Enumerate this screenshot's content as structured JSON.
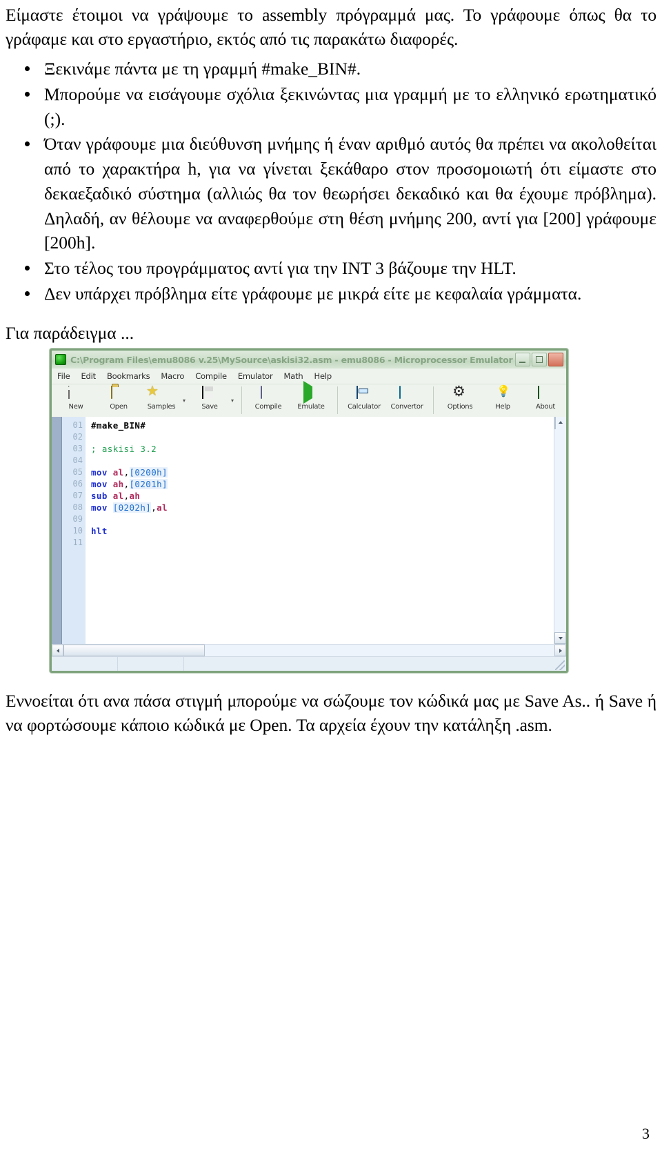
{
  "document": {
    "intro": "Είμαστε έτοιμοι να γράψουμε το assembly πρόγραμμά μας. Το γράφουμε όπως θα το γράφαμε και στο εργαστήριο, εκτός από τις παρακάτω διαφορές.",
    "bullets": [
      "Ξεκινάμε πάντα με τη γραμμή #make_BIN#.",
      "Μπορούμε να εισάγουμε σχόλια ξεκινώντας μια γραμμή με το ελληνικό ερωτηματικό (;).",
      "Όταν γράφουμε μια διεύθυνση μνήμης ή έναν αριθμό αυτός θα πρέπει να ακολοθείται από το χαρακτήρα h, για να γίνεται ξεκάθαρο στον προσομοιωτή ότι είμαστε στο δεκαεξαδικό σύστημα (αλλιώς θα τον θεωρήσει δεκαδικό και θα έχουμε πρόβλημα). Δηλαδή, αν θέλουμε να αναφερθούμε στη θέση μνήμης 200, αντί για [200] γράφουμε [200h].",
      "Στο τέλος του προγράμματος αντί για την INT 3 βάζουμε την HLT.",
      "Δεν υπάρχει πρόβλημα είτε γράφουμε με μικρά είτε με κεφαλαία γράμματα."
    ],
    "example_lead": "Για παράδειγμα ...",
    "footer": "Εννοείται ότι ανα πάσα στιγμή μπορούμε να σώζουμε τον κώδικά μας με Save As.. ή Save ή να φορτώσουμε κάποιο κώδικά με Open. Τα αρχεία έχουν την κατάληξη .asm.",
    "page_number": "3"
  },
  "screenshot": {
    "window": {
      "title": "C:\\Program Files\\emu8086 v.25\\MySource\\askisi32.asm - emu8086 - Microprocessor Emulator a...",
      "app_icon": "emu8086-icon",
      "buttons": [
        {
          "name": "minimize",
          "glyph": "_"
        },
        {
          "name": "maximize",
          "glyph": "□"
        },
        {
          "name": "close",
          "glyph": "✕"
        }
      ]
    },
    "menubar": [
      "File",
      "Edit",
      "Bookmarks",
      "Macro",
      "Compile",
      "Emulator",
      "Math",
      "Help"
    ],
    "toolbar": [
      {
        "label": "New",
        "icon": "new-file-icon",
        "dropdown": false
      },
      {
        "label": "Open",
        "icon": "open-folder-icon",
        "dropdown": false
      },
      {
        "label": "Samples",
        "icon": "star-icon",
        "dropdown": true
      },
      {
        "label": "Save",
        "icon": "floppy-disk-icon",
        "dropdown": true
      },
      {
        "label": "Compile",
        "icon": "compile-icon",
        "dropdown": false
      },
      {
        "label": "Emulate",
        "icon": "play-icon",
        "dropdown": false
      },
      {
        "label": "Calculator",
        "icon": "calculator-icon",
        "dropdown": false
      },
      {
        "label": "Convertor",
        "icon": "convertor-icon",
        "dropdown": false
      },
      {
        "label": "Options",
        "icon": "gear-icon",
        "dropdown": false
      },
      {
        "label": "Help",
        "icon": "lightbulb-icon",
        "dropdown": false
      },
      {
        "label": "About",
        "icon": "about-icon",
        "dropdown": false
      }
    ],
    "editor": {
      "line_numbers": [
        "01",
        "02",
        "03",
        "04",
        "05",
        "06",
        "07",
        "08",
        "09",
        "10",
        "11"
      ],
      "lines": [
        {
          "n": "01",
          "tokens": [
            {
              "t": "#make_BIN#",
              "c": "dir"
            }
          ]
        },
        {
          "n": "02",
          "tokens": []
        },
        {
          "n": "03",
          "tokens": [
            {
              "t": "; askisi 3.2",
              "c": "com"
            }
          ]
        },
        {
          "n": "04",
          "tokens": []
        },
        {
          "n": "05",
          "tokens": [
            {
              "t": "mov ",
              "c": "op"
            },
            {
              "t": "al",
              "c": "reg"
            },
            {
              "t": ",",
              "c": "plain"
            },
            {
              "t": "[0200h]",
              "c": "mem"
            }
          ]
        },
        {
          "n": "06",
          "tokens": [
            {
              "t": "mov ",
              "c": "op"
            },
            {
              "t": "ah",
              "c": "reg"
            },
            {
              "t": ",",
              "c": "plain"
            },
            {
              "t": "[0201h]",
              "c": "mem"
            }
          ]
        },
        {
          "n": "07",
          "tokens": [
            {
              "t": "sub ",
              "c": "op"
            },
            {
              "t": "al",
              "c": "reg"
            },
            {
              "t": ",",
              "c": "plain"
            },
            {
              "t": "ah",
              "c": "reg"
            }
          ]
        },
        {
          "n": "08",
          "tokens": [
            {
              "t": "mov ",
              "c": "op"
            },
            {
              "t": "[0202h]",
              "c": "mem"
            },
            {
              "t": ",",
              "c": "plain"
            },
            {
              "t": "al",
              "c": "reg"
            }
          ]
        },
        {
          "n": "09",
          "tokens": []
        },
        {
          "n": "10",
          "tokens": [
            {
              "t": "hlt",
              "c": "op"
            }
          ]
        },
        {
          "n": "11",
          "tokens": []
        }
      ],
      "raw_text": "#make_BIN#\n\n; askisi 3.2\n\nmov al,[0200h]\nmov ah,[0201h]\nsub al,ah\nmov [0202h],al\n\nhlt\n"
    },
    "statusbar": {
      "cells": [
        "",
        ""
      ]
    },
    "colors": {
      "title_bar": "#cfe0cd",
      "window_border": "#7ea37c",
      "toolbar_bg": "#eef3ed",
      "line_gutter": "#dbe8f7",
      "bookmark_gutter": "#9fb0c9",
      "keyword": "#1f2fd0",
      "register": "#b02a5b",
      "comment": "#1f9e4f",
      "memory_ref": "#1f6fd0"
    }
  }
}
